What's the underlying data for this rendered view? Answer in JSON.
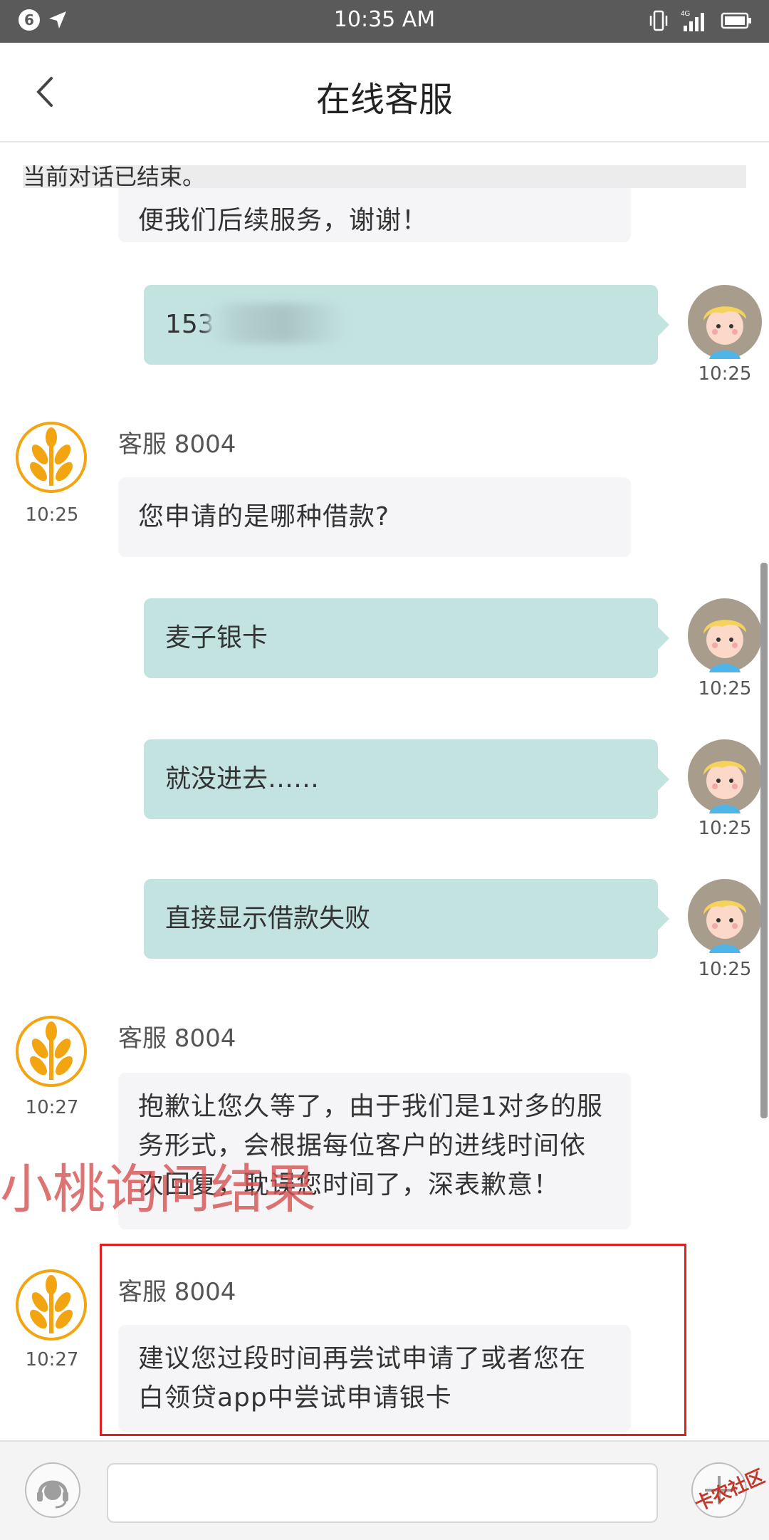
{
  "status_bar": {
    "notification_count": "6",
    "time": "10:35 AM",
    "network": "4G"
  },
  "nav": {
    "title": "在线客服"
  },
  "chat": {
    "system_notice": "当前对话已结束。",
    "messages": [
      {
        "sender": "agent",
        "text": "便我们后续服务，谢谢！"
      },
      {
        "sender": "user",
        "text": "153",
        "time": "10:25"
      },
      {
        "sender": "agent",
        "name": "客服 8004",
        "text": "您申请的是哪种借款?",
        "time": "10:25"
      },
      {
        "sender": "user",
        "text": "麦子银卡",
        "time": "10:25"
      },
      {
        "sender": "user",
        "text": "就没进去……",
        "time": "10:25"
      },
      {
        "sender": "user",
        "text": "直接显示借款失败",
        "time": "10:25"
      },
      {
        "sender": "agent",
        "name": "客服 8004",
        "text": "抱歉让您久等了，由于我们是1对多的服务形式，会根据每位客户的进线时间依次回复，耽误您时间了，深表歉意！",
        "time": "10:27"
      },
      {
        "sender": "agent",
        "name": "客服 8004",
        "text": "建议您过段时间再尝试申请了或者您在白领贷app中尝试申请银卡",
        "time": "10:27"
      }
    ]
  },
  "overlay": {
    "watermark_text": "小桃询问结果",
    "corner_logo": "卡农社区"
  },
  "input": {
    "placeholder": ""
  },
  "colors": {
    "status_bar": "#5a5a5a",
    "user_bubble": "#c3e3e1",
    "agent_bubble": "#f5f5f7",
    "agent_avatar": "#f3a511",
    "highlight_box": "#e02020",
    "watermark": "#d65050"
  },
  "icons": {
    "back": "chevron-left-icon",
    "customer_service": "headset-icon",
    "add": "plus-icon",
    "agent_avatar": "wheat-icon"
  }
}
